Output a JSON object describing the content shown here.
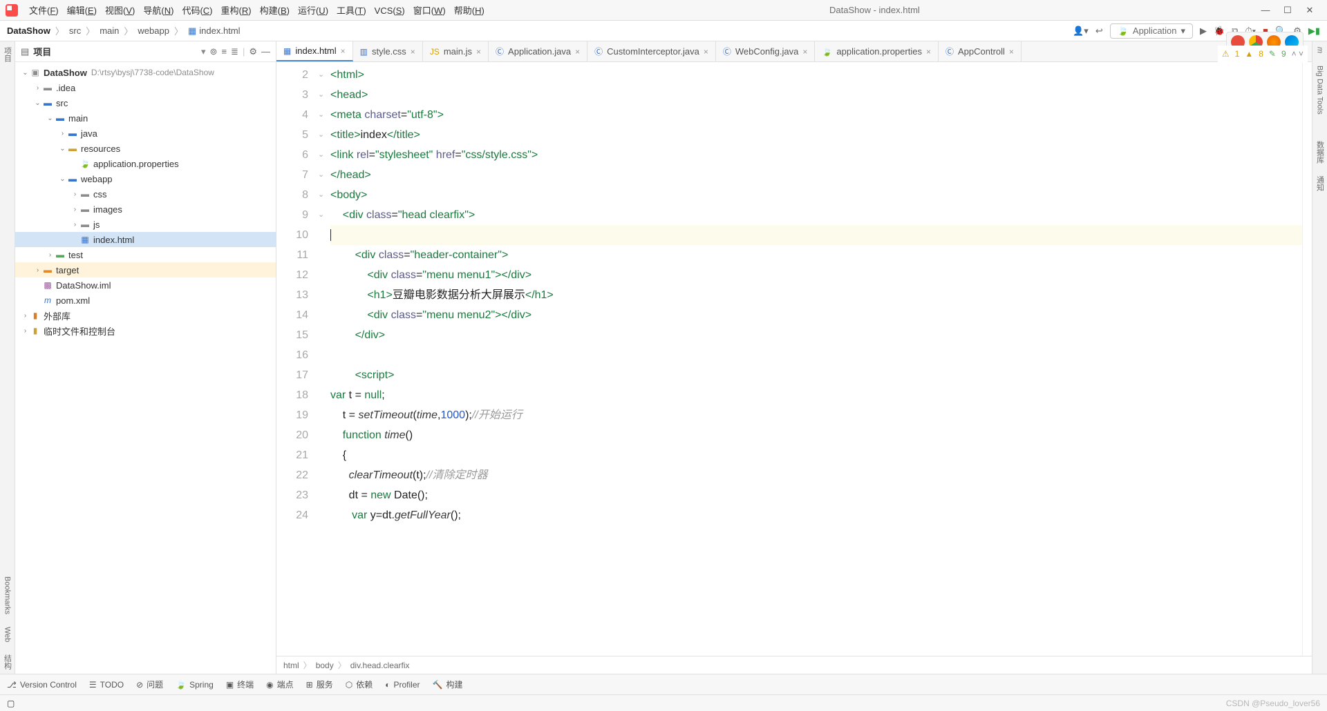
{
  "window": {
    "title": "DataShow - index.html"
  },
  "menubar": [
    "文件(F)",
    "编辑(E)",
    "视图(V)",
    "导航(N)",
    "代码(C)",
    "重构(R)",
    "构建(B)",
    "运行(U)",
    "工具(T)",
    "VCS(S)",
    "窗口(W)",
    "帮助(H)"
  ],
  "breadcrumbs": {
    "root": "DataShow",
    "parts": [
      "src",
      "main",
      "webapp",
      "index.html"
    ]
  },
  "run_config": "Application",
  "sidebar": {
    "title": "项目",
    "project_name": "DataShow",
    "project_path": "D:\\rtsy\\bysj\\7738-code\\DataShow",
    "tree": [
      {
        "d": 1,
        "label": ".idea",
        "type": "dir",
        "exp": false
      },
      {
        "d": 1,
        "label": "src",
        "type": "dir-blue",
        "exp": true
      },
      {
        "d": 2,
        "label": "main",
        "type": "dir-blue",
        "exp": true
      },
      {
        "d": 3,
        "label": "java",
        "type": "dir-blue",
        "exp": false
      },
      {
        "d": 3,
        "label": "resources",
        "type": "dir-gold",
        "exp": true
      },
      {
        "d": 4,
        "label": "application.properties",
        "type": "prop"
      },
      {
        "d": 3,
        "label": "webapp",
        "type": "dir-blue",
        "exp": true
      },
      {
        "d": 4,
        "label": "css",
        "type": "dir",
        "exp": false
      },
      {
        "d": 4,
        "label": "images",
        "type": "dir",
        "exp": false
      },
      {
        "d": 4,
        "label": "js",
        "type": "dir",
        "exp": false
      },
      {
        "d": 4,
        "label": "index.html",
        "type": "html",
        "sel": true
      },
      {
        "d": 2,
        "label": "test",
        "type": "dir-green",
        "exp": false
      },
      {
        "d": 1,
        "label": "target",
        "type": "dir-orange",
        "exp": false,
        "hl": true
      },
      {
        "d": 1,
        "label": "DataShow.iml",
        "type": "iml"
      },
      {
        "d": 1,
        "label": "pom.xml",
        "type": "maven"
      }
    ],
    "extras": [
      "外部库",
      "临时文件和控制台"
    ]
  },
  "tabs": [
    {
      "label": "index.html",
      "icon": "html",
      "active": true
    },
    {
      "label": "style.css",
      "icon": "css"
    },
    {
      "label": "main.js",
      "icon": "js"
    },
    {
      "label": "Application.java",
      "icon": "java"
    },
    {
      "label": "CustomInterceptor.java",
      "icon": "java"
    },
    {
      "label": "WebConfig.java",
      "icon": "java"
    },
    {
      "label": "application.properties",
      "icon": "prop"
    },
    {
      "label": "AppControll",
      "icon": "java"
    }
  ],
  "indicators": {
    "warn": "1",
    "weak": "8",
    "typo": "9"
  },
  "code": {
    "lines": [
      {
        "n": 2,
        "html": "<span class='tag'>&lt;html&gt;</span>"
      },
      {
        "n": 3,
        "html": "<span class='tag'>&lt;head&gt;</span>"
      },
      {
        "n": 4,
        "html": "<span class='tag'>&lt;meta</span> <span class='attr'>charset</span>=<span class='str'>\"utf-8\"</span><span class='tag'>&gt;</span>"
      },
      {
        "n": 5,
        "html": "<span class='tag'>&lt;title&gt;</span>index<span class='tag'>&lt;/title&gt;</span>"
      },
      {
        "n": 6,
        "html": "<span class='tag'>&lt;link</span> <span class='attr'>rel</span>=<span class='str'>\"stylesheet\"</span> <span class='attr'>href</span>=<span class='str'>\"css/style.css\"</span><span class='tag'>&gt;</span>"
      },
      {
        "n": 7,
        "html": "<span class='tag'>&lt;/head&gt;</span>"
      },
      {
        "n": 8,
        "html": "<span class='tag'>&lt;body&gt;</span>"
      },
      {
        "n": 9,
        "html": "    <span class='tag'>&lt;div</span> <span class='attr'>class</span>=<span class='str'>\"head clearfix\"</span><span class='tag'>&gt;</span>"
      },
      {
        "n": 10,
        "html": "<span class='caret'></span>",
        "cur": true
      },
      {
        "n": 11,
        "html": "        <span class='tag'>&lt;div</span> <span class='attr'>class</span>=<span class='str'>\"header-container\"</span><span class='tag'>&gt;</span>"
      },
      {
        "n": 12,
        "html": "            <span class='tag'>&lt;div</span> <span class='attr'>class</span>=<span class='str'>\"menu menu1\"</span><span class='tag'>&gt;&lt;/div&gt;</span>"
      },
      {
        "n": 13,
        "html": "            <span class='tag'>&lt;h1&gt;</span>豆瓣电影数据分析大屏展示<span class='tag'>&lt;/h1&gt;</span>"
      },
      {
        "n": 14,
        "html": "            <span class='tag'>&lt;div</span> <span class='attr'>class</span>=<span class='str'>\"menu menu2\"</span><span class='tag'>&gt;&lt;/div&gt;</span>"
      },
      {
        "n": 15,
        "html": "        <span class='tag'>&lt;/div&gt;</span>"
      },
      {
        "n": 16,
        "html": ""
      },
      {
        "n": 17,
        "html": "        <span class='tag'>&lt;script&gt;</span>"
      },
      {
        "n": 18,
        "html": "<span class='kw'>var</span> t = <span class='kw'>null</span>;"
      },
      {
        "n": 19,
        "html": "    t = <span class='fn'>setTimeout</span>(<span class='fn'>time</span>,<span class='num'>1000</span>);<span class='cm'>//开始运行</span>"
      },
      {
        "n": 20,
        "html": "    <span class='kw'>function</span> <span class='fn'>time</span>()"
      },
      {
        "n": 21,
        "html": "    {"
      },
      {
        "n": 22,
        "html": "      <span class='fn'>clearTimeout</span>(t);<span class='cm'>//清除定时器</span>"
      },
      {
        "n": 23,
        "html": "      dt = <span class='kw'>new</span> Date();"
      },
      {
        "n": 24,
        "html": "       <span class='kw'>var</span> y=dt.<span class='fn'>getFullYear</span>();"
      }
    ]
  },
  "breadcrumb_bottom": [
    "html",
    "body",
    "div.head.clearfix"
  ],
  "bottom_tools": [
    "Version Control",
    "TODO",
    "问题",
    "Spring",
    "终端",
    "端点",
    "服务",
    "依赖",
    "Profiler",
    "构建"
  ],
  "status": {
    "watermark": "CSDN @Pseudo_lover56"
  },
  "float_browsers": [
    "ij",
    "chrome",
    "firefox",
    "edge"
  ],
  "right_tools": [
    "Maven",
    "Big Data Tools",
    "数据库",
    "通知"
  ],
  "left_tools": [
    "项目",
    "Bookmarks",
    "Web",
    "结构"
  ]
}
